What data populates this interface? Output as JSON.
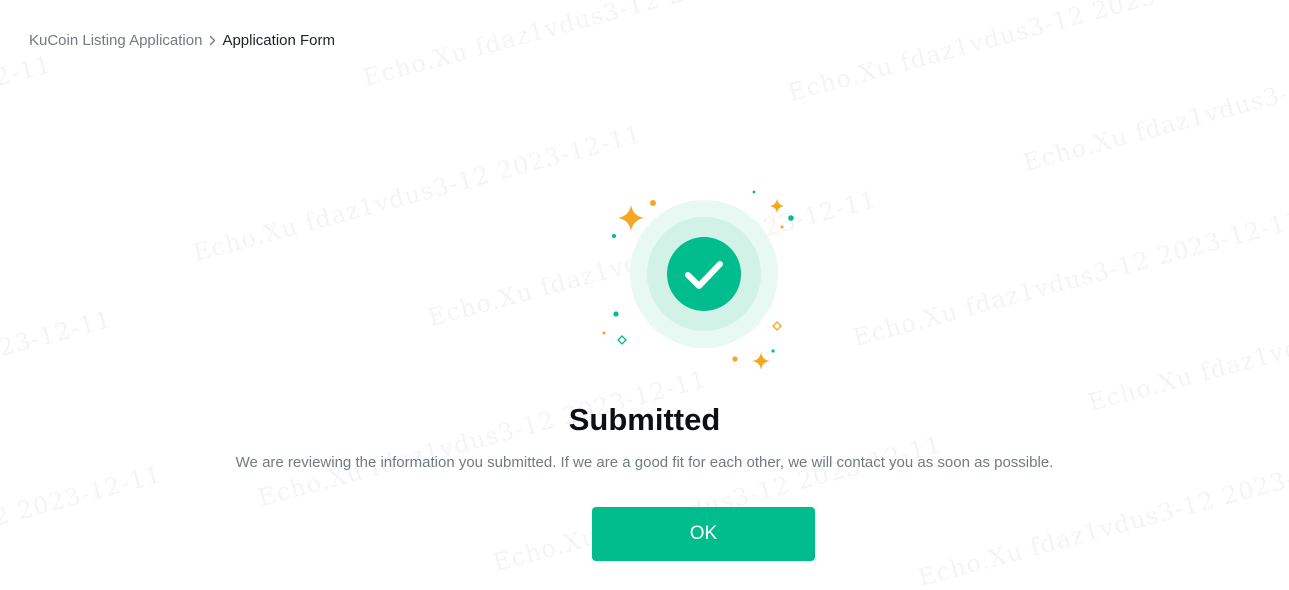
{
  "breadcrumb": {
    "parent": "KuCoin Listing Application",
    "current": "Application Form"
  },
  "result": {
    "title": "Submitted",
    "message": "We are reviewing the information you submitted. If we are a good fit for each other, we will contact you as soon as possible.",
    "ok_label": "OK",
    "status_icon": "check-circle-icon"
  },
  "watermark": {
    "text": "Echo.Xu fdaz1vdus3-12 2023-12-11"
  },
  "colors": {
    "accent": "#01bc8d",
    "sparkle": "#f5a623",
    "title": "#0d1117",
    "muted": "#737a82"
  }
}
